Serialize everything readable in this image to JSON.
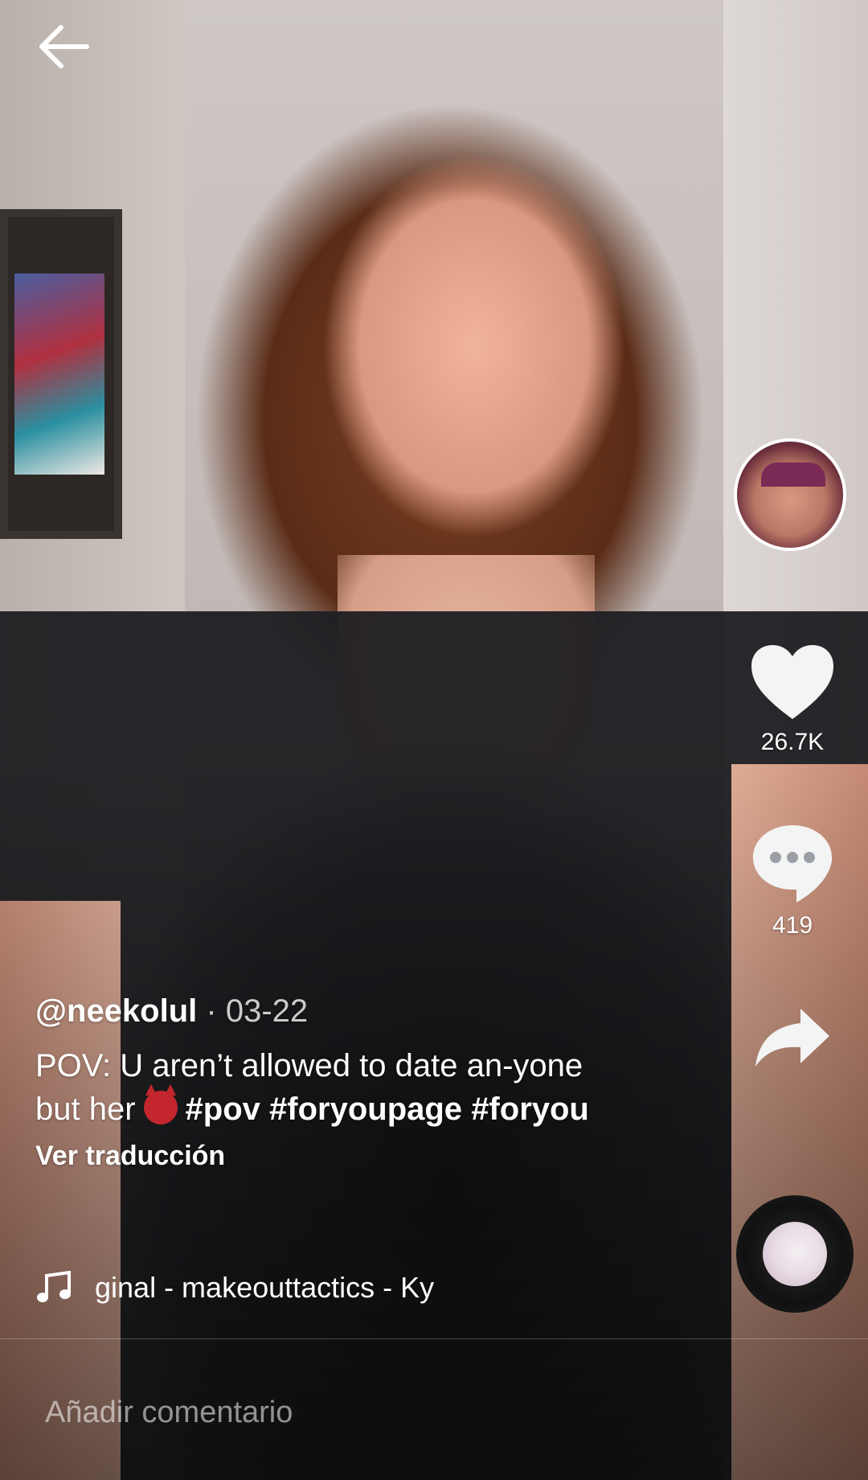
{
  "nav": {
    "back_icon": "arrow-left-icon"
  },
  "video": {
    "description": "video frame"
  },
  "rail": {
    "avatar_icon": "creator-avatar",
    "like": {
      "icon": "heart-icon",
      "count": "26.7K"
    },
    "comment": {
      "icon": "comment-bubble-icon",
      "count": "419"
    },
    "share": {
      "icon": "share-arrow-icon"
    },
    "sound_disc_icon": "sound-disc-icon"
  },
  "caption": {
    "handle": "@neekolul",
    "separator": " · ",
    "date": "03-22",
    "text": "POV: U aren’t allowed to date an-yone but her",
    "emoji": "devil-emoji",
    "hashtags": [
      "#pov",
      "#foryoupage",
      "#foryou"
    ],
    "translate": "Ver traducción"
  },
  "music": {
    "icon": "music-note-icon",
    "text": "ginal - makeouttactics - Ky"
  },
  "comment": {
    "placeholder": "Añadir comentario"
  },
  "colors": {
    "text": "#ffffff",
    "placeholder": "#ffffff8c"
  }
}
